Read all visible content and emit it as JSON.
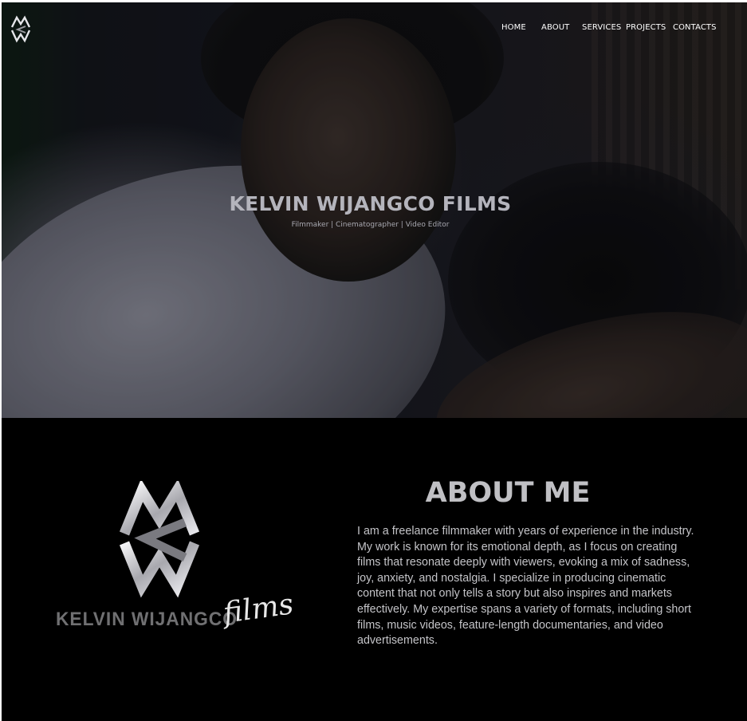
{
  "nav": {
    "logo_icon": "mw-monogram-logo",
    "items": [
      {
        "label": "HOME"
      },
      {
        "label": "ABOUT"
      },
      {
        "label": "SERVICES"
      },
      {
        "label": "PROJECTS"
      },
      {
        "label": "CONTACTS"
      }
    ]
  },
  "hero": {
    "title": "KELVIN WIJANGCO FILMS",
    "subtitle": "Filmmaker | Cinematographer | Video Editor"
  },
  "about": {
    "logo_icon": "mw-monogram-logo",
    "brand_name": "KELVIN WIJANGCO",
    "brand_script": "films",
    "title": "ABOUT ME",
    "body": "I am a freelance filmmaker with years of experience in the industry. My work is known for its emotional depth, as I focus on creating films that resonate deeply with viewers, evoking a mix of sadness, joy, anxiety, and nostalgia. I specialize in producing cinematic content that not only tells a story but also inspires and markets effectively. My expertise spans a variety of formats, including short films, music videos, feature-length documentaries, and video advertisements."
  },
  "colors": {
    "page_background": "#000000",
    "nav_text": "#ffffff",
    "heading": "#c0c0c4",
    "body_text": "#c4c4c8"
  }
}
